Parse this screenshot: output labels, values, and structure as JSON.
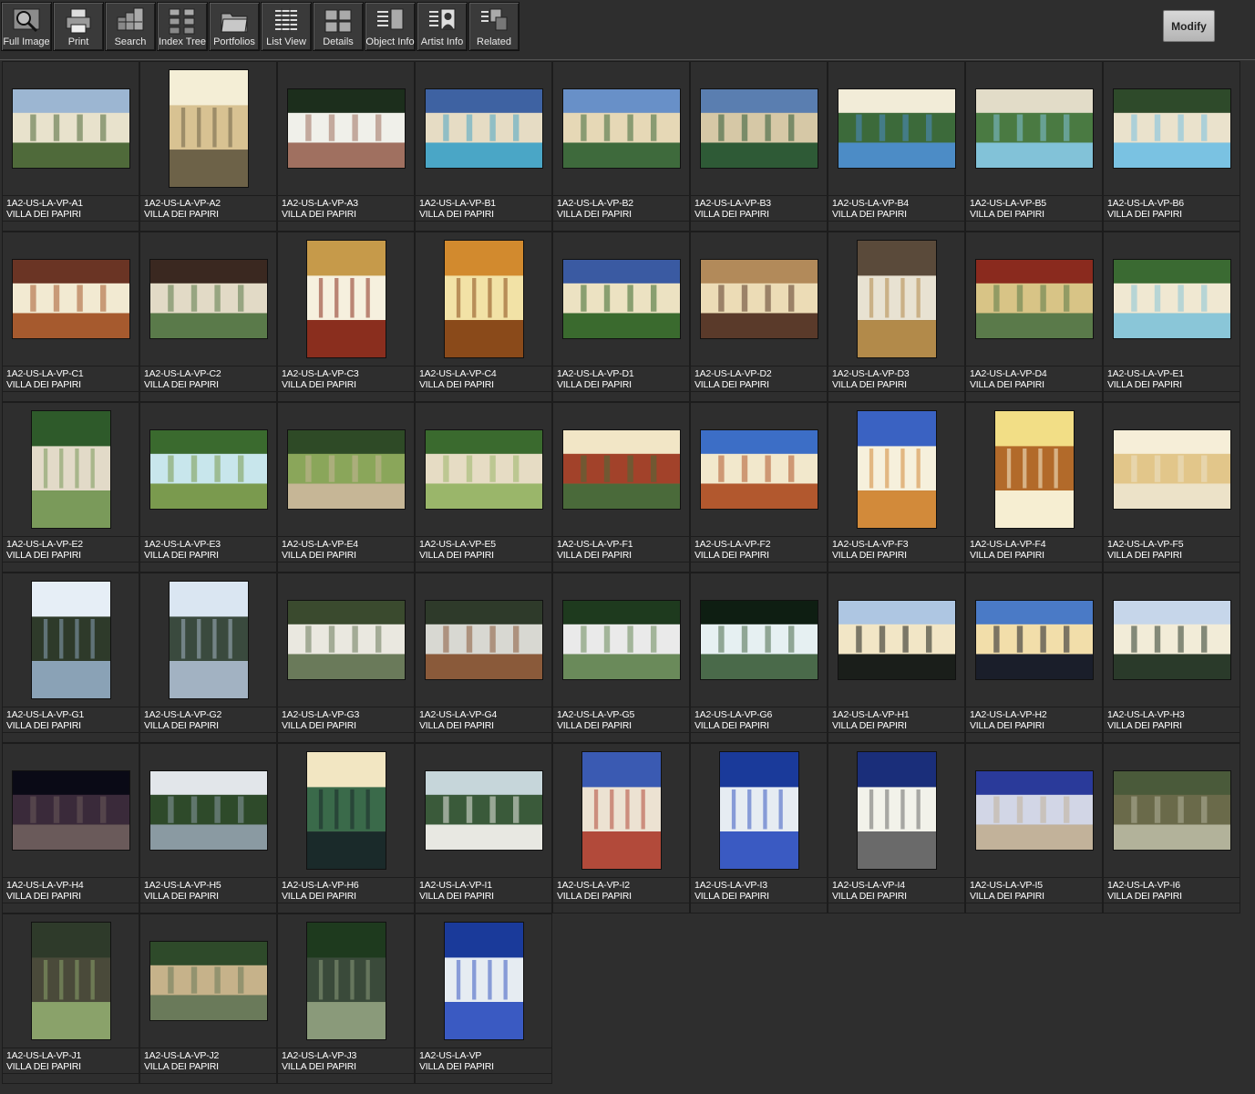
{
  "toolbar": {
    "buttons": [
      {
        "label": "Full Image",
        "icon": "magnifier-icon"
      },
      {
        "label": "Print",
        "icon": "printer-icon"
      },
      {
        "label": "Search",
        "icon": "search-stack-icon"
      },
      {
        "label": "Index Tree",
        "icon": "index-tree-icon"
      },
      {
        "label": "Portfolios",
        "icon": "folder-icon"
      },
      {
        "label": "List View",
        "icon": "list-view-icon"
      },
      {
        "label": "Details",
        "icon": "details-grid-icon"
      },
      {
        "label": "Object Info",
        "icon": "object-info-icon"
      },
      {
        "label": "Artist  Info",
        "icon": "artist-portrait-icon"
      },
      {
        "label": "Related",
        "icon": "related-icon"
      }
    ],
    "modify_label": "Modify"
  },
  "thumbnails": [
    {
      "id": "1A2-US-LA-VP-A1",
      "title": "VILLA DEI PAPIRI",
      "orientation": "landscape",
      "palette": [
        "#9cb6d2",
        "#e8e2cc",
        "#4f6a3a"
      ]
    },
    {
      "id": "1A2-US-LA-VP-A2",
      "title": "VILLA DEI PAPIRI",
      "orientation": "portrait",
      "palette": [
        "#f4eed6",
        "#d8c292",
        "#6d6248"
      ]
    },
    {
      "id": "1A2-US-LA-VP-A3",
      "title": "VILLA DEI PAPIRI",
      "orientation": "landscape",
      "palette": [
        "#1c2e1c",
        "#f0f0ea",
        "#a07060"
      ]
    },
    {
      "id": "1A2-US-LA-VP-B1",
      "title": "VILLA DEI PAPIRI",
      "orientation": "landscape",
      "palette": [
        "#3e62a2",
        "#e6dcc4",
        "#4aa6c6"
      ]
    },
    {
      "id": "1A2-US-LA-VP-B2",
      "title": "VILLA DEI PAPIRI",
      "orientation": "landscape",
      "palette": [
        "#6890c8",
        "#e6d8b6",
        "#3e6a3c"
      ]
    },
    {
      "id": "1A2-US-LA-VP-B3",
      "title": "VILLA DEI PAPIRI",
      "orientation": "landscape",
      "palette": [
        "#5a7eb0",
        "#d6c8a6",
        "#2e5a36"
      ]
    },
    {
      "id": "1A2-US-LA-VP-B4",
      "title": "VILLA DEI PAPIRI",
      "orientation": "landscape",
      "palette": [
        "#f2ecd8",
        "#3c6a3a",
        "#4c8cc6"
      ]
    },
    {
      "id": "1A2-US-LA-VP-B5",
      "title": "VILLA DEI PAPIRI",
      "orientation": "landscape",
      "palette": [
        "#e2dcc8",
        "#4a7a42",
        "#82c2d8"
      ]
    },
    {
      "id": "1A2-US-LA-VP-B6",
      "title": "VILLA DEI PAPIRI",
      "orientation": "landscape",
      "palette": [
        "#2e4a2a",
        "#eae2cc",
        "#7ac2e2"
      ]
    },
    {
      "id": "1A2-US-LA-VP-C1",
      "title": "VILLA DEI PAPIRI",
      "orientation": "landscape",
      "palette": [
        "#6a3424",
        "#f2ead2",
        "#a65a2e"
      ]
    },
    {
      "id": "1A2-US-LA-VP-C2",
      "title": "VILLA DEI PAPIRI",
      "orientation": "landscape",
      "palette": [
        "#3a2820",
        "#e2dac6",
        "#5a7a4a"
      ]
    },
    {
      "id": "1A2-US-LA-VP-C3",
      "title": "VILLA DEI PAPIRI",
      "orientation": "portrait",
      "palette": [
        "#c69a4a",
        "#f6f0de",
        "#8a2e1e"
      ]
    },
    {
      "id": "1A2-US-LA-VP-C4",
      "title": "VILLA DEI PAPIRI",
      "orientation": "portrait",
      "palette": [
        "#d28a2e",
        "#f2e2a6",
        "#8a4a1a"
      ]
    },
    {
      "id": "1A2-US-LA-VP-D1",
      "title": "VILLA DEI PAPIRI",
      "orientation": "landscape",
      "palette": [
        "#3a5aa2",
        "#ece2c2",
        "#3a6a2e"
      ]
    },
    {
      "id": "1A2-US-LA-VP-D2",
      "title": "VILLA DEI PAPIRI",
      "orientation": "landscape",
      "palette": [
        "#b28a5a",
        "#ecdcb6",
        "#5a3a2a"
      ]
    },
    {
      "id": "1A2-US-LA-VP-D3",
      "title": "VILLA DEI PAPIRI",
      "orientation": "portrait",
      "palette": [
        "#5a4a3a",
        "#e8e2d2",
        "#b28a4a"
      ]
    },
    {
      "id": "1A2-US-LA-VP-D4",
      "title": "VILLA DEI PAPIRI",
      "orientation": "landscape",
      "palette": [
        "#8a2a1e",
        "#d8c486",
        "#5a7a4a"
      ]
    },
    {
      "id": "1A2-US-LA-VP-E1",
      "title": "VILLA DEI PAPIRI",
      "orientation": "landscape",
      "palette": [
        "#3a6a32",
        "#f0e8d2",
        "#8ac6d8"
      ]
    },
    {
      "id": "1A2-US-LA-VP-E2",
      "title": "VILLA DEI PAPIRI",
      "orientation": "portrait",
      "palette": [
        "#2e5a2a",
        "#e2dac8",
        "#7a9a5a"
      ]
    },
    {
      "id": "1A2-US-LA-VP-E3",
      "title": "VILLA DEI PAPIRI",
      "orientation": "landscape",
      "palette": [
        "#3a6a2e",
        "#c8e6ec",
        "#7a9a4e"
      ]
    },
    {
      "id": "1A2-US-LA-VP-E4",
      "title": "VILLA DEI PAPIRI",
      "orientation": "landscape",
      "palette": [
        "#2e4a26",
        "#8aa65a",
        "#c6b696"
      ]
    },
    {
      "id": "1A2-US-LA-VP-E5",
      "title": "VILLA DEI PAPIRI",
      "orientation": "landscape",
      "palette": [
        "#3a6a2e",
        "#e6dcc4",
        "#9ab66a"
      ]
    },
    {
      "id": "1A2-US-LA-VP-F1",
      "title": "VILLA DEI PAPIRI",
      "orientation": "landscape",
      "palette": [
        "#f2e6c6",
        "#a2422a",
        "#4a6a3a"
      ]
    },
    {
      "id": "1A2-US-LA-VP-F2",
      "title": "VILLA DEI PAPIRI",
      "orientation": "landscape",
      "palette": [
        "#3c6ec6",
        "#f2e8cc",
        "#b2582e"
      ]
    },
    {
      "id": "1A2-US-LA-VP-F3",
      "title": "VILLA DEI PAPIRI",
      "orientation": "portrait",
      "palette": [
        "#3a62c2",
        "#f6f0dc",
        "#d28a3a"
      ]
    },
    {
      "id": "1A2-US-LA-VP-F4",
      "title": "VILLA DEI PAPIRI",
      "orientation": "portrait",
      "palette": [
        "#f2de86",
        "#b26a2a",
        "#f6eed2"
      ]
    },
    {
      "id": "1A2-US-LA-VP-F5",
      "title": "VILLA DEI PAPIRI",
      "orientation": "landscape",
      "palette": [
        "#f6eed8",
        "#e2c68a",
        "#ece2c8"
      ]
    },
    {
      "id": "1A2-US-LA-VP-G1",
      "title": "VILLA DEI PAPIRI",
      "orientation": "portrait",
      "palette": [
        "#e6eef6",
        "#2e3a2a",
        "#8aa2b6"
      ]
    },
    {
      "id": "1A2-US-LA-VP-G2",
      "title": "VILLA DEI PAPIRI",
      "orientation": "portrait",
      "palette": [
        "#dae6f2",
        "#3a4a3e",
        "#a2b2c2"
      ]
    },
    {
      "id": "1A2-US-LA-VP-G3",
      "title": "VILLA DEI PAPIRI",
      "orientation": "landscape",
      "palette": [
        "#3a4a2e",
        "#eae8e0",
        "#6a7a5a"
      ]
    },
    {
      "id": "1A2-US-LA-VP-G4",
      "title": "VILLA DEI PAPIRI",
      "orientation": "landscape",
      "palette": [
        "#2e3a2a",
        "#d8d8d2",
        "#8a5a3a"
      ]
    },
    {
      "id": "1A2-US-LA-VP-G5",
      "title": "VILLA DEI PAPIRI",
      "orientation": "landscape",
      "palette": [
        "#1e3a1e",
        "#eaeaea",
        "#6a8a5a"
      ]
    },
    {
      "id": "1A2-US-LA-VP-G6",
      "title": "VILLA DEI PAPIRI",
      "orientation": "landscape",
      "palette": [
        "#0e1e12",
        "#e6f0f2",
        "#4a6a4a"
      ]
    },
    {
      "id": "1A2-US-LA-VP-H1",
      "title": "VILLA DEI PAPIRI",
      "orientation": "landscape",
      "palette": [
        "#aec6e2",
        "#f2e6c6",
        "#1a1e1a"
      ]
    },
    {
      "id": "1A2-US-LA-VP-H2",
      "title": "VILLA DEI PAPIRI",
      "orientation": "landscape",
      "palette": [
        "#4a7ac6",
        "#f2deaa",
        "#1a1e2a"
      ]
    },
    {
      "id": "1A2-US-LA-VP-H3",
      "title": "VILLA DEI PAPIRI",
      "orientation": "landscape",
      "palette": [
        "#c6d6ea",
        "#f2ecd8",
        "#2a3a2a"
      ]
    },
    {
      "id": "1A2-US-LA-VP-H4",
      "title": "VILLA DEI PAPIRI",
      "orientation": "landscape",
      "palette": [
        "#0a0a16",
        "#3a2a3a",
        "#6a5a5a"
      ]
    },
    {
      "id": "1A2-US-LA-VP-H5",
      "title": "VILLA DEI PAPIRI",
      "orientation": "landscape",
      "palette": [
        "#e2e6ea",
        "#2e4a2a",
        "#8a9aa2"
      ]
    },
    {
      "id": "1A2-US-LA-VP-H6",
      "title": "VILLA DEI PAPIRI",
      "orientation": "portrait",
      "palette": [
        "#f2e6c2",
        "#3a6a4a",
        "#1a2a2a"
      ]
    },
    {
      "id": "1A2-US-LA-VP-I1",
      "title": "VILLA DEI PAPIRI",
      "orientation": "landscape",
      "palette": [
        "#c6d6da",
        "#3a5a3a",
        "#e8e8e2"
      ]
    },
    {
      "id": "1A2-US-LA-VP-I2",
      "title": "VILLA DEI PAPIRI",
      "orientation": "portrait",
      "palette": [
        "#3a5ab2",
        "#ece2d2",
        "#b24a3a"
      ]
    },
    {
      "id": "1A2-US-LA-VP-I3",
      "title": "VILLA DEI PAPIRI",
      "orientation": "portrait",
      "palette": [
        "#1a3a9a",
        "#e6ecf2",
        "#3a5ac2"
      ]
    },
    {
      "id": "1A2-US-LA-VP-I4",
      "title": "VILLA DEI PAPIRI",
      "orientation": "portrait",
      "palette": [
        "#1a2e7a",
        "#f2f2ea",
        "#6a6a6a"
      ]
    },
    {
      "id": "1A2-US-LA-VP-I5",
      "title": "VILLA DEI PAPIRI",
      "orientation": "landscape",
      "palette": [
        "#2a3a9a",
        "#d2d6e6",
        "#c2b29a"
      ]
    },
    {
      "id": "1A2-US-LA-VP-I6",
      "title": "VILLA DEI PAPIRI",
      "orientation": "landscape",
      "palette": [
        "#4a5a3a",
        "#6a6a4a",
        "#b2b29a"
      ]
    },
    {
      "id": "1A2-US-LA-VP-J1",
      "title": "VILLA DEI PAPIRI",
      "orientation": "portrait",
      "palette": [
        "#2e3a2a",
        "#4a4a3a",
        "#8aa26a"
      ]
    },
    {
      "id": "1A2-US-LA-VP-J2",
      "title": "VILLA DEI PAPIRI",
      "orientation": "landscape",
      "palette": [
        "#2e4a2a",
        "#c6b28a",
        "#6a7a5a"
      ]
    },
    {
      "id": "1A2-US-LA-VP-J3",
      "title": "VILLA DEI PAPIRI",
      "orientation": "portrait",
      "palette": [
        "#1e3a1e",
        "#3a4a3a",
        "#8a9a7a"
      ]
    },
    {
      "id": "1A2-US-LA-VP",
      "title": "VILLA DEI PAPIRI",
      "orientation": "portrait",
      "palette": [
        "#1a3a9a",
        "#e6ecf2",
        "#3a5ac2"
      ]
    }
  ]
}
